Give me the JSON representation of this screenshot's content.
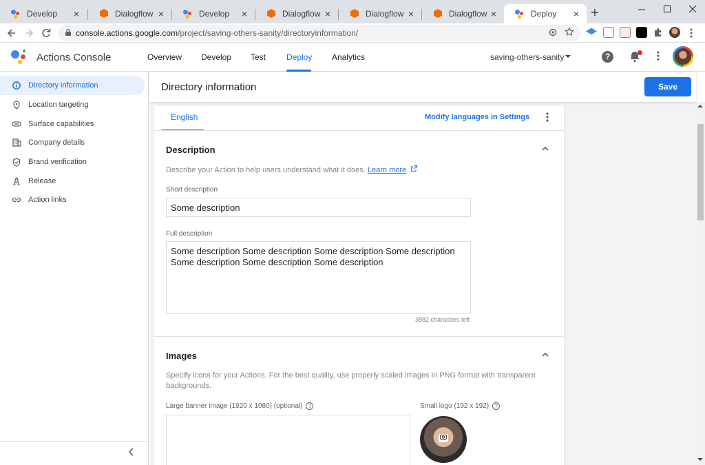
{
  "browser": {
    "tabs": [
      {
        "title": "Develop",
        "icon": "actions-icon"
      },
      {
        "title": "Dialogflow",
        "icon": "dialogflow-icon"
      },
      {
        "title": "Develop",
        "icon": "actions-icon"
      },
      {
        "title": "Dialogflow",
        "icon": "dialogflow-icon"
      },
      {
        "title": "Dialogflow",
        "icon": "dialogflow-icon"
      },
      {
        "title": "Dialogflow",
        "icon": "dialogflow-icon"
      },
      {
        "title": "Deploy",
        "icon": "actions-icon",
        "active": true
      }
    ],
    "tab_close_glyph": "×",
    "new_tab_glyph": "+",
    "url_host": "console.actions.google.com",
    "url_path": "/project/saving-others-sanity/directoryinformation/"
  },
  "app": {
    "name": "Actions Console",
    "nav": [
      "Overview",
      "Develop",
      "Test",
      "Deploy",
      "Analytics"
    ],
    "active_nav": "Deploy",
    "project": "saving-others-sanity",
    "help_glyph": "?"
  },
  "sidebar": {
    "items": [
      {
        "label": "Directory information",
        "icon": "info-icon",
        "active": true
      },
      {
        "label": "Location targeting",
        "icon": "location-pin-icon"
      },
      {
        "label": "Surface capabilities",
        "icon": "link-pill-icon"
      },
      {
        "label": "Company details",
        "icon": "building-icon"
      },
      {
        "label": "Brand verification",
        "icon": "shield-check-icon"
      },
      {
        "label": "Release",
        "icon": "rocket-icon"
      },
      {
        "label": "Action links",
        "icon": "link-icon"
      }
    ]
  },
  "page": {
    "title": "Directory information",
    "save_label": "Save",
    "language_tab": "English",
    "modify_languages": "Modify languages in Settings"
  },
  "description": {
    "title": "Description",
    "helper": "Describe your Action to help users understand what it does.",
    "learn_more": "Learn more",
    "short_label": "Short description",
    "short_value": "Some description",
    "full_label": "Full description",
    "full_value": "Some description Some description Some description Some description Some description Some description Some description",
    "chars_left": "3882 characters left"
  },
  "images": {
    "title": "Images",
    "helper": "Specify icons for your Actions. For the best quality, use properly scaled images in PNG format with transparent backgrounds.",
    "banner_label": "Large banner image (1920 x 1080) (optional)",
    "logo_label": "Small logo (192 x 192)"
  },
  "colors": {
    "accent": "#1a73e8",
    "active_bg": "#e8f0fe",
    "dialogflow": "#ef6c00"
  }
}
